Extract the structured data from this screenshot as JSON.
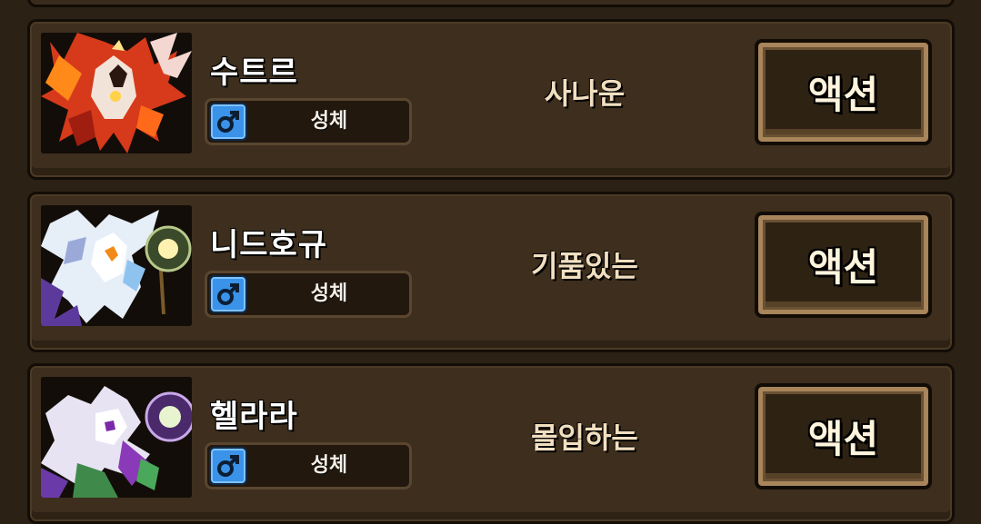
{
  "creatures": [
    {
      "name": "수트르",
      "type": "성체",
      "trait": "사나운",
      "action": "액션",
      "gender_icon": "male-icon",
      "portrait_icon": "fire-dragon-icon"
    },
    {
      "name": "니드호규",
      "type": "성체",
      "trait": "기품있는",
      "action": "액션",
      "gender_icon": "male-icon",
      "portrait_icon": "ice-dragon-icon"
    },
    {
      "name": "헬라라",
      "type": "성체",
      "trait": "몰입하는",
      "action": "액션",
      "gender_icon": "male-icon",
      "portrait_icon": "shadow-dragon-icon"
    }
  ],
  "colors": {
    "panel": "#3d2e1d",
    "border": "#130d07",
    "gender_blue": "#3a93e8",
    "button_frame": "#a8855a",
    "trait_text": "#f1dfc0"
  }
}
